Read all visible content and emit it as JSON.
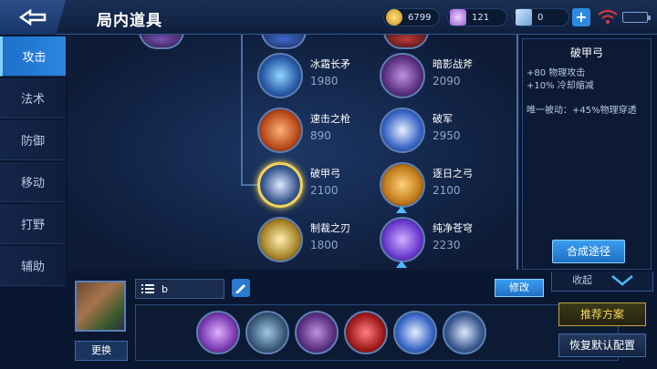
{
  "header": {
    "title": "局内道具",
    "gold": "6799",
    "diamonds": "121",
    "coupons": "0"
  },
  "sidebar": {
    "items": [
      {
        "label": "攻击"
      },
      {
        "label": "法术"
      },
      {
        "label": "防御"
      },
      {
        "label": "移动"
      },
      {
        "label": "打野"
      },
      {
        "label": "辅助"
      }
    ],
    "active_index": 0
  },
  "items_grid": [
    {
      "name": "冰霜长矛",
      "price": "1980"
    },
    {
      "name": "暗影战斧",
      "price": "2090"
    },
    {
      "name": "速击之枪",
      "price": "890"
    },
    {
      "name": "破军",
      "price": "2950"
    },
    {
      "name": "破甲弓",
      "price": "2100"
    },
    {
      "name": "逐日之弓",
      "price": "2100"
    },
    {
      "name": "制裁之刃",
      "price": "1800"
    },
    {
      "name": "纯净苍穹",
      "price": "2230"
    }
  ],
  "detail": {
    "title": "破甲弓",
    "attr1": "+80 物理攻击",
    "attr2": "+10% 冷却缩减",
    "passive": "唯一被动：+45%物理穿透",
    "compose_label": "合成途径"
  },
  "collapse_label": "收起",
  "bottom": {
    "search_value": "b",
    "modify_label": "修改",
    "change_label": "更换",
    "recommend_label": "推荐方案",
    "reset_label": "恢复默认配置"
  },
  "colors": {
    "accent": "#2a87e0",
    "gold": "#f2d35c"
  }
}
